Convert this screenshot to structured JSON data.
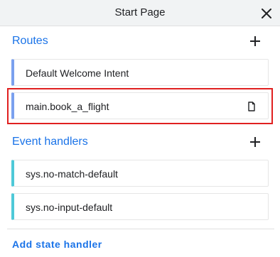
{
  "header": {
    "title": "Start Page"
  },
  "routes": {
    "title": "Routes",
    "items": [
      {
        "label": "Default Welcome Intent"
      },
      {
        "label": "main.book_a_flight"
      }
    ]
  },
  "event_handlers": {
    "title": "Event handlers",
    "items": [
      {
        "label": "sys.no-match-default"
      },
      {
        "label": "sys.no-input-default"
      }
    ]
  },
  "footer": {
    "add_state_handler_label": "Add state handler"
  },
  "colors": {
    "accent": "#1a73e8",
    "route_bar": "#7aa0ef",
    "event_bar": "#4ec9d8",
    "selection": "#e02020"
  },
  "icons": {
    "close": "close-icon",
    "add": "plus-icon",
    "page": "page-icon"
  }
}
